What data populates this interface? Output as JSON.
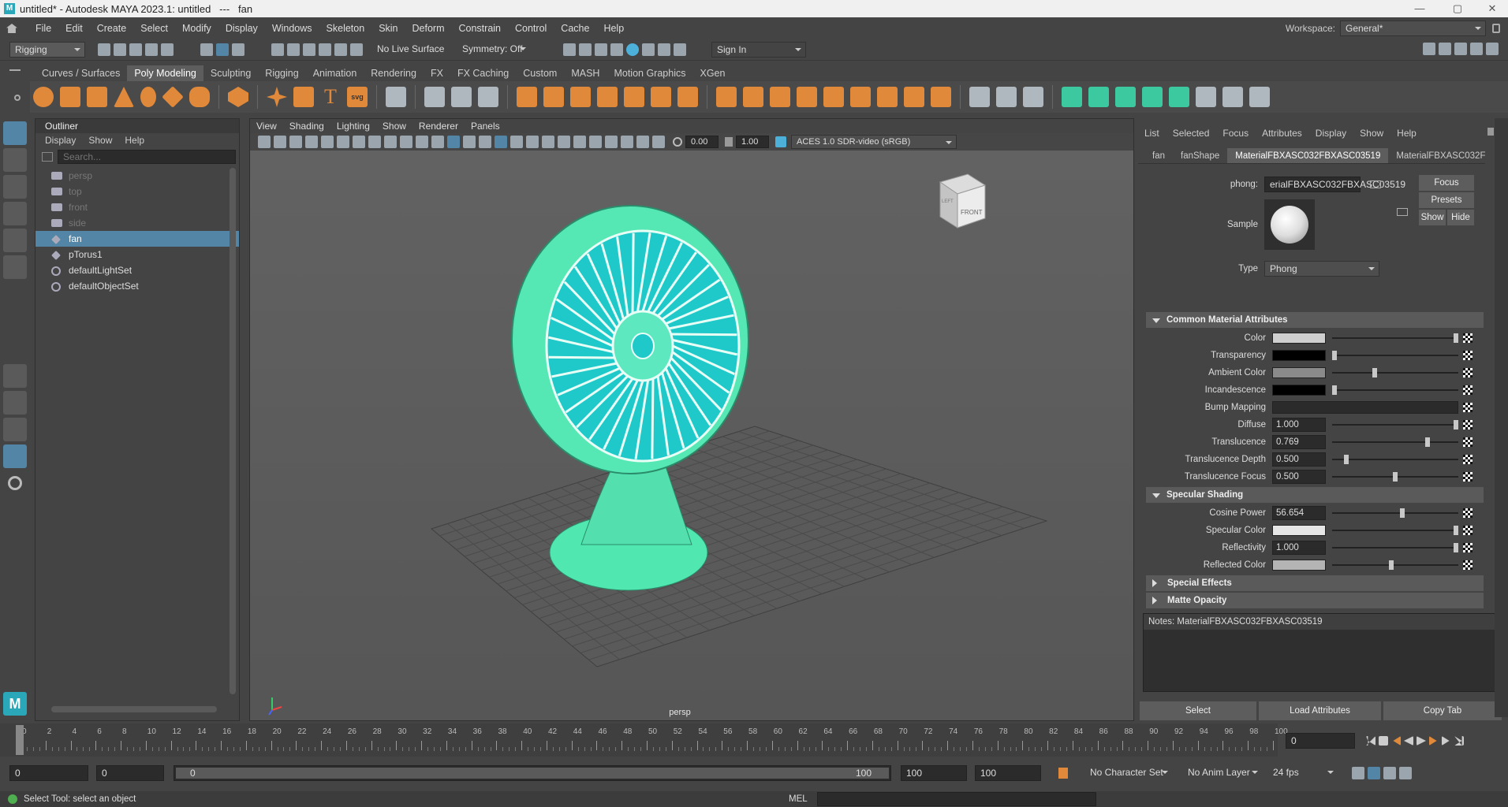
{
  "window": {
    "title": "untitled* - Autodesk MAYA 2023.1: untitled   ---   fan",
    "min": "—",
    "max": "▢",
    "close": "✕"
  },
  "menu": [
    "File",
    "Edit",
    "Create",
    "Select",
    "Modify",
    "Display",
    "Windows",
    "Skeleton",
    "Skin",
    "Deform",
    "Constrain",
    "Control",
    "Cache",
    "Help"
  ],
  "workspace": {
    "label": "Workspace:",
    "value": "General*"
  },
  "statusline": {
    "mode": "Rigging",
    "live_surface": "No Live Surface",
    "symmetry": "Symmetry: Off",
    "sign_in": "Sign In"
  },
  "shelf_tabs": [
    {
      "label": "Curves / Surfaces",
      "active": false
    },
    {
      "label": "Poly Modeling",
      "active": true
    },
    {
      "label": "Sculpting",
      "active": false
    },
    {
      "label": "Rigging",
      "active": false
    },
    {
      "label": "Animation",
      "active": false
    },
    {
      "label": "Rendering",
      "active": false
    },
    {
      "label": "FX",
      "active": false
    },
    {
      "label": "FX Caching",
      "active": false
    },
    {
      "label": "Custom",
      "active": false
    },
    {
      "label": "MASH",
      "active": false
    },
    {
      "label": "Motion Graphics",
      "active": false
    },
    {
      "label": "XGen",
      "active": false
    }
  ],
  "outliner": {
    "title": "Outliner",
    "menu": [
      "Display",
      "Show",
      "Help"
    ],
    "search_placeholder": "Search...",
    "items": [
      {
        "label": "persp",
        "dim": true,
        "selected": false,
        "icon": "camera-icon"
      },
      {
        "label": "top",
        "dim": true,
        "selected": false,
        "icon": "camera-icon"
      },
      {
        "label": "front",
        "dim": true,
        "selected": false,
        "icon": "camera-icon"
      },
      {
        "label": "side",
        "dim": true,
        "selected": false,
        "icon": "camera-icon"
      },
      {
        "label": "fan",
        "dim": false,
        "selected": true,
        "icon": "mesh-icon"
      },
      {
        "label": "pTorus1",
        "dim": false,
        "selected": false,
        "icon": "mesh-icon"
      },
      {
        "label": "defaultLightSet",
        "dim": false,
        "selected": false,
        "icon": "set-icon"
      },
      {
        "label": "defaultObjectSet",
        "dim": false,
        "selected": false,
        "icon": "set-icon"
      }
    ]
  },
  "viewport": {
    "menu": [
      "View",
      "Shading",
      "Lighting",
      "Show",
      "Renderer",
      "Panels"
    ],
    "exposure": "0.00",
    "gamma": "1.00",
    "colorspace": "ACES 1.0 SDR-video (sRGB)",
    "camera": "persp",
    "cube_left": "LEFT",
    "cube_front": "FRONT"
  },
  "attr": {
    "menu": [
      "List",
      "Selected",
      "Focus",
      "Attributes",
      "Display",
      "Show",
      "Help"
    ],
    "tabs": [
      {
        "label": "fan",
        "active": false
      },
      {
        "label": "fanShape",
        "active": false
      },
      {
        "label": "MaterialFBXASC032FBXASC03519",
        "active": true
      },
      {
        "label": "MaterialFBXASC032F",
        "active": false
      }
    ],
    "node_label": "phong:",
    "node_value": "erialFBXASC032FBXASC03519",
    "focus": "Focus",
    "presets": "Presets",
    "show": "Show",
    "hide": "Hide",
    "sample": "Sample",
    "type_label": "Type",
    "type_value": "Phong",
    "sec_common": "Common Material Attributes",
    "common": [
      {
        "label": "Color",
        "kind": "swatch",
        "color": "#cfcfcf",
        "slider": 1.0
      },
      {
        "label": "Transparency",
        "kind": "swatch",
        "color": "#000000",
        "slider": 0.0
      },
      {
        "label": "Ambient Color",
        "kind": "swatch",
        "color": "#8a8a8a",
        "slider": 0.33
      },
      {
        "label": "Incandescence",
        "kind": "swatch",
        "color": "#000000",
        "slider": 0.0
      },
      {
        "label": "Bump Mapping",
        "kind": "map",
        "value": ""
      },
      {
        "label": "Diffuse",
        "kind": "value",
        "value": "1.000",
        "slider": 1.0
      },
      {
        "label": "Translucence",
        "kind": "value",
        "value": "0.769",
        "slider": 0.769
      },
      {
        "label": "Translucence Depth",
        "kind": "value",
        "value": "0.500",
        "slider": 0.1
      },
      {
        "label": "Translucence Focus",
        "kind": "value",
        "value": "0.500",
        "slider": 0.5
      }
    ],
    "sec_spec": "Specular Shading",
    "spec": [
      {
        "label": "Cosine Power",
        "kind": "value",
        "value": "56.654",
        "slider": 0.56
      },
      {
        "label": "Specular Color",
        "kind": "swatch",
        "color": "#e6e6e6",
        "slider": 1.0
      },
      {
        "label": "Reflectivity",
        "kind": "value",
        "value": "1.000",
        "slider": 1.0
      },
      {
        "label": "Reflected Color",
        "kind": "swatch",
        "color": "#b4b4b4",
        "slider": 0.47
      }
    ],
    "sec_special": "Special Effects",
    "sec_matte": "Matte Opacity",
    "notes": "Notes:  MaterialFBXASC032FBXASC03519",
    "btn_select": "Select",
    "btn_load": "Load Attributes",
    "btn_copy": "Copy Tab"
  },
  "timeline": {
    "ticks": [
      "0",
      "2",
      "4",
      "6",
      "8",
      "10",
      "12",
      "14",
      "16",
      "18",
      "20",
      "22",
      "24",
      "26",
      "28",
      "30",
      "32",
      "34",
      "36",
      "38",
      "40",
      "42",
      "44",
      "46",
      "48",
      "50",
      "52",
      "54",
      "56",
      "58",
      "60",
      "62",
      "64",
      "66",
      "68",
      "70",
      "72",
      "74",
      "76",
      "78",
      "80",
      "82",
      "84",
      "86",
      "88",
      "90",
      "92",
      "94",
      "96",
      "98",
      "100"
    ],
    "current": "0"
  },
  "range": {
    "start": "0",
    "start2": "0",
    "bar_start": "0",
    "bar_end": "100",
    "end": "100",
    "end2": "100",
    "char_set": "No Character Set",
    "anim_layer": "No Anim Layer",
    "fps": "24 fps"
  },
  "status": {
    "message": "Select Tool: select an object",
    "lang": "MEL"
  }
}
